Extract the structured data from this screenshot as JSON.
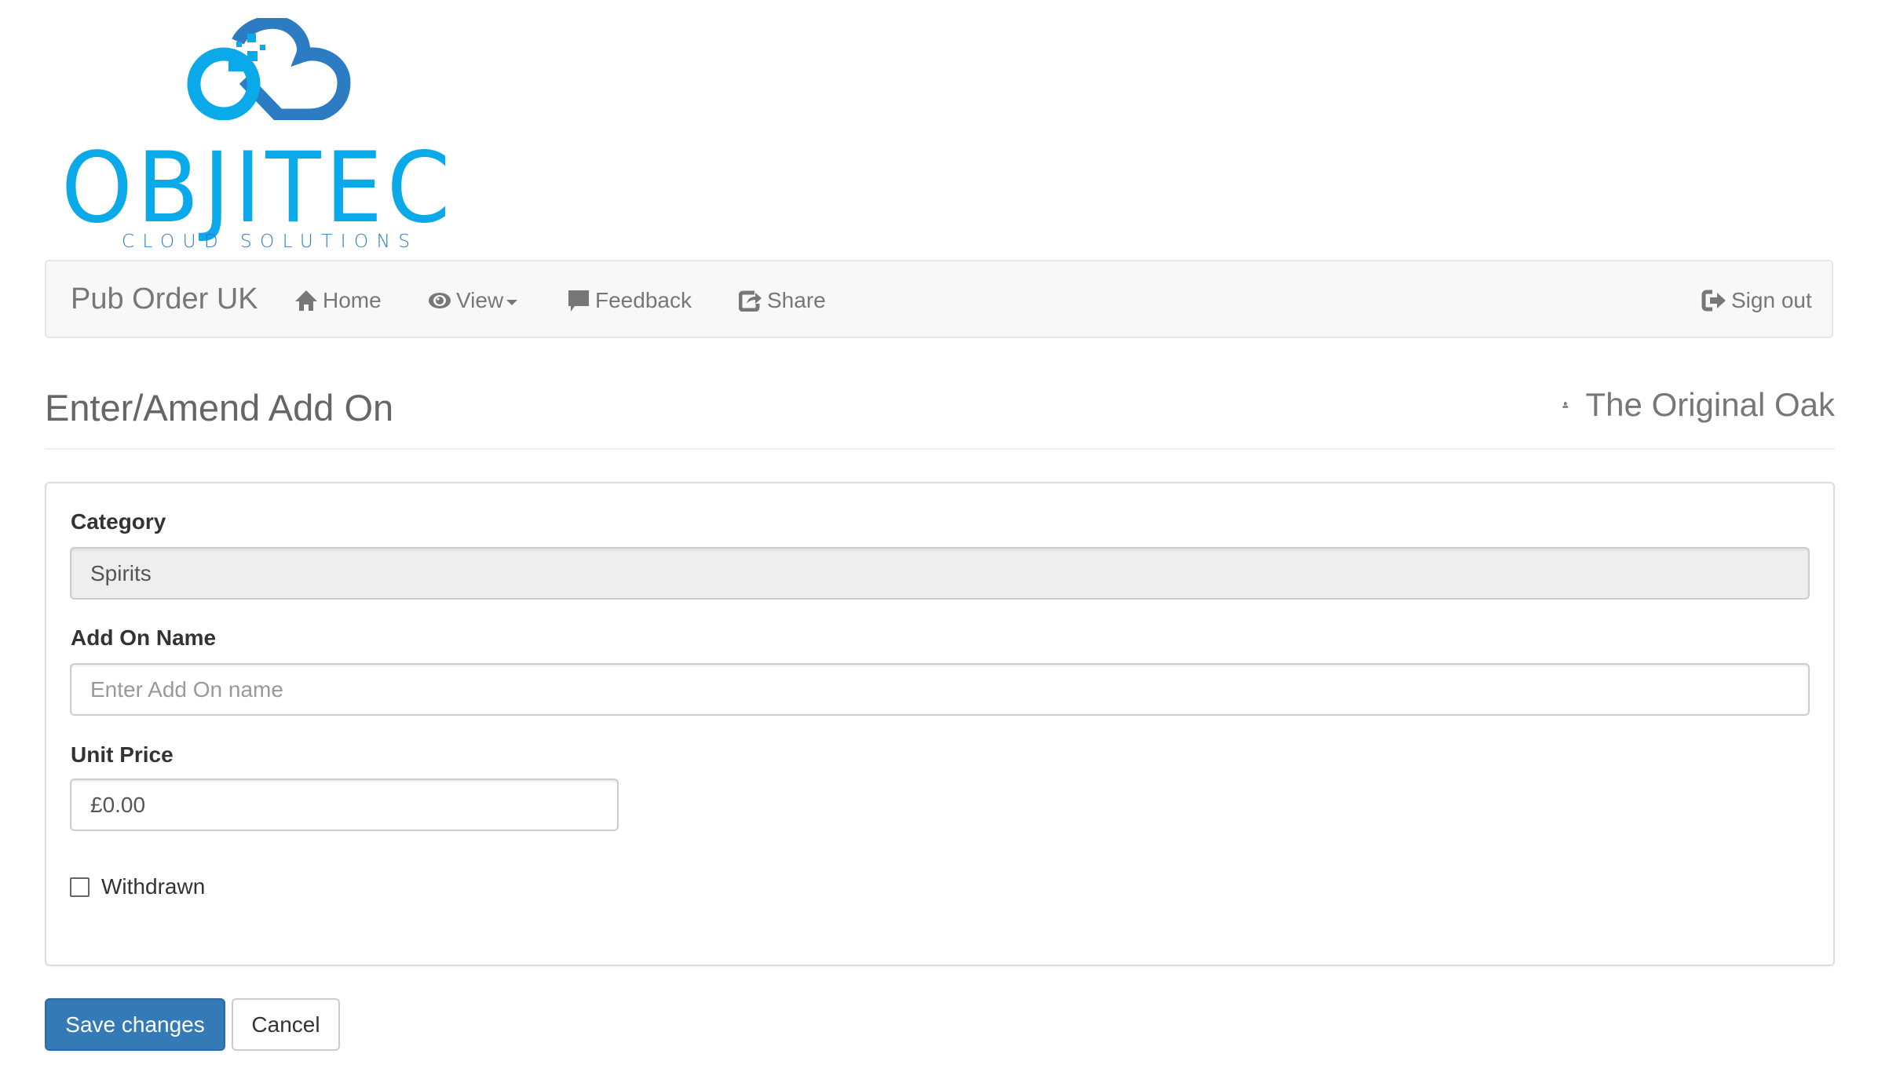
{
  "logo": {
    "name": "OBJITEC",
    "tagline": "CLOUD SOLUTIONS",
    "colors": {
      "light_blue": "#0aa9ea",
      "dark_blue": "#2b7cc2"
    }
  },
  "navbar": {
    "brand": "Pub Order UK",
    "items": [
      {
        "label": "Home",
        "icon": "home-icon"
      },
      {
        "label": "View",
        "icon": "eye-icon",
        "dropdown": true
      },
      {
        "label": "Feedback",
        "icon": "comment-icon"
      },
      {
        "label": "Share",
        "icon": "share-icon"
      }
    ],
    "sign_out": {
      "label": "Sign out",
      "icon": "log-out-icon"
    }
  },
  "header": {
    "title": "Enter/Amend Add On",
    "venue": "The Original Oak",
    "venue_icon": "user-icon"
  },
  "form": {
    "category": {
      "label": "Category",
      "value": "Spirits",
      "readonly": true
    },
    "add_on_name": {
      "label": "Add On Name",
      "value": "",
      "placeholder": "Enter Add On name"
    },
    "unit_price": {
      "label": "Unit Price",
      "value": "£0.00"
    },
    "withdrawn": {
      "label": "Withdrawn",
      "checked": false
    }
  },
  "actions": {
    "save_label": "Save changes",
    "cancel_label": "Cancel",
    "primary_color": "#337ab7"
  }
}
